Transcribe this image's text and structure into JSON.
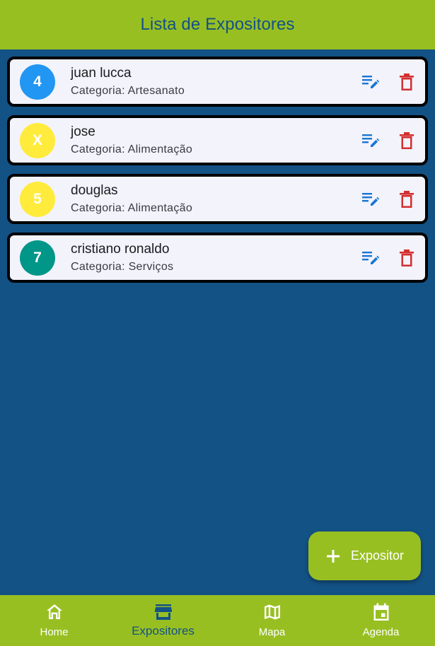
{
  "app_bar": {
    "title": "Lista de Expositores"
  },
  "exhibitors": [
    {
      "avatar_text": "4",
      "avatar_color": "#2196f3",
      "name": "juan lucca",
      "category": "Categoria: Artesanato"
    },
    {
      "avatar_text": "X",
      "avatar_color": "#ffeb3b",
      "name": "jose",
      "category": "Categoria: Alimentação"
    },
    {
      "avatar_text": "5",
      "avatar_color": "#ffeb3b",
      "name": "douglas",
      "category": "Categoria: Alimentação"
    },
    {
      "avatar_text": "7",
      "avatar_color": "#009688",
      "name": "cristiano ronaldo",
      "category": "Categoria: Serviços"
    }
  ],
  "fab": {
    "label": "Expositor",
    "icon": "plus-icon"
  },
  "bottom_nav": {
    "items": [
      {
        "label": "Home",
        "icon": "home-icon"
      },
      {
        "label": "Expositores",
        "icon": "store-icon",
        "active": true
      },
      {
        "label": "Mapa",
        "icon": "map-icon"
      },
      {
        "label": "Agenda",
        "icon": "calendar-icon"
      }
    ]
  },
  "colors": {
    "background": "#135285",
    "bar_green": "#98bf22",
    "edit_blue": "#1976d2",
    "delete_red": "#d32f2f",
    "card_bg": "#f2f3fb"
  },
  "icons": {
    "edit": "edit-note-icon",
    "delete": "trash-icon"
  }
}
